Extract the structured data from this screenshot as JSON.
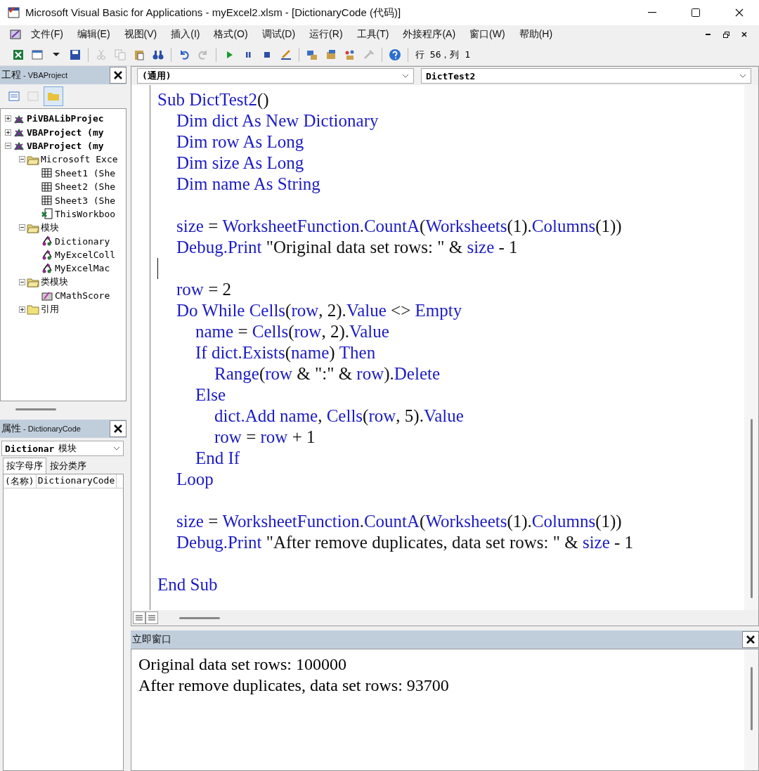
{
  "window": {
    "title": "Microsoft Visual Basic for Applications - myExcel2.xlsm - [DictionaryCode (代码)]"
  },
  "menu": [
    "文件(F)",
    "编辑(E)",
    "视图(V)",
    "插入(I)",
    "格式(O)",
    "调试(D)",
    "运行(R)",
    "工具(T)",
    "外接程序(A)",
    "窗口(W)",
    "帮助(H)"
  ],
  "toolbar": [
    {
      "kind": "excel",
      "disabled": false
    },
    {
      "kind": "form",
      "disabled": false
    },
    {
      "kind": "dropdown",
      "disabled": false
    },
    {
      "kind": "save",
      "disabled": false
    },
    {
      "kind": "sep"
    },
    {
      "kind": "cut",
      "disabled": true
    },
    {
      "kind": "copy",
      "disabled": true
    },
    {
      "kind": "paste",
      "disabled": false
    },
    {
      "kind": "find",
      "disabled": false
    },
    {
      "kind": "sep"
    },
    {
      "kind": "undo",
      "disabled": false
    },
    {
      "kind": "redo",
      "disabled": true
    },
    {
      "kind": "sep"
    },
    {
      "kind": "run",
      "disabled": false
    },
    {
      "kind": "pause",
      "disabled": false
    },
    {
      "kind": "stop",
      "disabled": false
    },
    {
      "kind": "design",
      "disabled": false
    },
    {
      "kind": "sep"
    },
    {
      "kind": "explorer",
      "disabled": false
    },
    {
      "kind": "properties",
      "disabled": false
    },
    {
      "kind": "toolbox",
      "disabled": false
    },
    {
      "kind": "tools",
      "disabled": true
    },
    {
      "kind": "sep"
    },
    {
      "kind": "help",
      "disabled": false
    }
  ],
  "cursor_position": "行 56，列 1",
  "project": {
    "title": "工程",
    "subtitle": " - VBAProject",
    "tree": [
      {
        "label": "PiVBALibProjec",
        "kind": "project",
        "expanded": false
      },
      {
        "label": "VBAProject (my",
        "kind": "project",
        "expanded": false
      },
      {
        "label": "VBAProject (my",
        "kind": "project",
        "expanded": true,
        "children": [
          {
            "label": "Microsoft Exce",
            "kind": "folder",
            "expanded": true,
            "children": [
              {
                "label": "Sheet1 (She",
                "kind": "sheet"
              },
              {
                "label": "Sheet2 (She",
                "kind": "sheet"
              },
              {
                "label": "Sheet3 (She",
                "kind": "sheet"
              },
              {
                "label": "ThisWorkboo",
                "kind": "workbook"
              }
            ]
          },
          {
            "label": "模块",
            "kind": "folder",
            "expanded": true,
            "children": [
              {
                "label": "Dictionary",
                "kind": "module"
              },
              {
                "label": "MyExcelColl",
                "kind": "module"
              },
              {
                "label": "MyExcelMac",
                "kind": "module"
              }
            ]
          },
          {
            "label": "类模块",
            "kind": "folder",
            "expanded": true,
            "children": [
              {
                "label": "CMathScore",
                "kind": "class"
              }
            ]
          },
          {
            "label": "引用",
            "kind": "closed-folder",
            "expanded": false
          }
        ]
      }
    ]
  },
  "properties": {
    "title": "属性",
    "subtitle": " - DictionaryCode",
    "object": "Dictionar",
    "object_type": "模块",
    "tabs": [
      {
        "label": "按字母序",
        "selected": true
      },
      {
        "label": "按分类序",
        "selected": false
      }
    ],
    "rows": [
      {
        "name": "(名称)",
        "value": "DictionaryCode"
      }
    ]
  },
  "code": {
    "object_combo": "(通用)",
    "proc_combo": "DictTest2",
    "lines": [
      {
        "kind": "code",
        "segs": [
          {
            "t": "Sub DictTest2",
            "kind": "kw"
          },
          {
            "t": "()",
            "kind": "plain"
          }
        ]
      },
      {
        "kind": "code",
        "segs": [
          {
            "t": "\tDim dict As New Dictionary",
            "kind": "kw"
          }
        ]
      },
      {
        "kind": "code",
        "segs": [
          {
            "t": "\tDim row As Long",
            "kind": "kw"
          }
        ]
      },
      {
        "kind": "code",
        "segs": [
          {
            "t": "\tDim size As Long",
            "kind": "kw"
          }
        ]
      },
      {
        "kind": "code",
        "segs": [
          {
            "t": "\tDim name As String",
            "kind": "kw"
          }
        ]
      },
      {
        "kind": "blank"
      },
      {
        "kind": "code",
        "segs": [
          {
            "t": "\tsize",
            "kind": "kw"
          },
          {
            "t": " = ",
            "kind": "plain"
          },
          {
            "t": "WorksheetFunction",
            "kind": "kw"
          },
          {
            "t": ".",
            "kind": "plain"
          },
          {
            "t": "CountA",
            "kind": "kw"
          },
          {
            "t": "(",
            "kind": "plain"
          },
          {
            "t": "Worksheets",
            "kind": "kw"
          },
          {
            "t": "(1).",
            "kind": "plain"
          },
          {
            "t": "Columns",
            "kind": "kw"
          },
          {
            "t": "(1))",
            "kind": "plain"
          }
        ]
      },
      {
        "kind": "code",
        "segs": [
          {
            "t": "\tDebug.Print",
            "kind": "kw"
          },
          {
            "t": " \"Original data set rows: \" & ",
            "kind": "plain"
          },
          {
            "t": "size",
            "kind": "kw"
          },
          {
            "t": " - 1",
            "kind": "plain"
          }
        ]
      },
      {
        "kind": "cursor"
      },
      {
        "kind": "code",
        "segs": [
          {
            "t": "\trow",
            "kind": "kw"
          },
          {
            "t": " = 2",
            "kind": "plain"
          }
        ]
      },
      {
        "kind": "code",
        "segs": [
          {
            "t": "\tDo While Cells",
            "kind": "kw"
          },
          {
            "t": "(",
            "kind": "plain"
          },
          {
            "t": "row",
            "kind": "kw"
          },
          {
            "t": ", 2).",
            "kind": "plain"
          },
          {
            "t": "Value",
            "kind": "kw"
          },
          {
            "t": " <> ",
            "kind": "plain"
          },
          {
            "t": "Empty",
            "kind": "kw"
          }
        ]
      },
      {
        "kind": "code",
        "segs": [
          {
            "t": "\t\tname",
            "kind": "kw"
          },
          {
            "t": " = ",
            "kind": "plain"
          },
          {
            "t": "Cells",
            "kind": "kw"
          },
          {
            "t": "(",
            "kind": "plain"
          },
          {
            "t": "row",
            "kind": "kw"
          },
          {
            "t": ", 2).",
            "kind": "plain"
          },
          {
            "t": "Value",
            "kind": "kw"
          }
        ]
      },
      {
        "kind": "code",
        "segs": [
          {
            "t": "\t\tIf dict.Exists",
            "kind": "kw"
          },
          {
            "t": "(",
            "kind": "plain"
          },
          {
            "t": "name",
            "kind": "kw"
          },
          {
            "t": ") ",
            "kind": "plain"
          },
          {
            "t": "Then",
            "kind": "kw"
          }
        ]
      },
      {
        "kind": "code",
        "segs": [
          {
            "t": "\t\t\tRange",
            "kind": "kw"
          },
          {
            "t": "(",
            "kind": "plain"
          },
          {
            "t": "row",
            "kind": "kw"
          },
          {
            "t": " & \":\" & ",
            "kind": "plain"
          },
          {
            "t": "row",
            "kind": "kw"
          },
          {
            "t": ").",
            "kind": "plain"
          },
          {
            "t": "Delete",
            "kind": "kw"
          }
        ]
      },
      {
        "kind": "code",
        "segs": [
          {
            "t": "\t\tElse",
            "kind": "kw"
          }
        ]
      },
      {
        "kind": "code",
        "segs": [
          {
            "t": "\t\t\tdict.Add name",
            "kind": "kw"
          },
          {
            "t": ", ",
            "kind": "plain"
          },
          {
            "t": "Cells",
            "kind": "kw"
          },
          {
            "t": "(",
            "kind": "plain"
          },
          {
            "t": "row",
            "kind": "kw"
          },
          {
            "t": ", 5).",
            "kind": "plain"
          },
          {
            "t": "Value",
            "kind": "kw"
          }
        ]
      },
      {
        "kind": "code",
        "segs": [
          {
            "t": "\t\t\trow",
            "kind": "kw"
          },
          {
            "t": " = ",
            "kind": "plain"
          },
          {
            "t": "row",
            "kind": "kw"
          },
          {
            "t": " + 1",
            "kind": "plain"
          }
        ]
      },
      {
        "kind": "code",
        "segs": [
          {
            "t": "\t\tEnd If",
            "kind": "kw"
          }
        ]
      },
      {
        "kind": "code",
        "segs": [
          {
            "t": "\tLoop",
            "kind": "kw"
          }
        ]
      },
      {
        "kind": "blank"
      },
      {
        "kind": "code",
        "segs": [
          {
            "t": "\tsize",
            "kind": "kw"
          },
          {
            "t": " = ",
            "kind": "plain"
          },
          {
            "t": "WorksheetFunction",
            "kind": "kw"
          },
          {
            "t": ".",
            "kind": "plain"
          },
          {
            "t": "CountA",
            "kind": "kw"
          },
          {
            "t": "(",
            "kind": "plain"
          },
          {
            "t": "Worksheets",
            "kind": "kw"
          },
          {
            "t": "(1).",
            "kind": "plain"
          },
          {
            "t": "Columns",
            "kind": "kw"
          },
          {
            "t": "(1))",
            "kind": "plain"
          }
        ]
      },
      {
        "kind": "code",
        "segs": [
          {
            "t": "\tDebug.Print",
            "kind": "kw"
          },
          {
            "t": " \"After remove duplicates, data set rows: \" & ",
            "kind": "plain"
          },
          {
            "t": "size",
            "kind": "kw"
          },
          {
            "t": " - 1",
            "kind": "plain"
          }
        ]
      },
      {
        "kind": "blank"
      },
      {
        "kind": "code",
        "segs": [
          {
            "t": "End Sub",
            "kind": "kw"
          }
        ]
      }
    ]
  },
  "immediate": {
    "title": "立即窗口",
    "lines": [
      "Original data set rows: 100000",
      "After remove duplicates, data set rows: 93700"
    ]
  }
}
